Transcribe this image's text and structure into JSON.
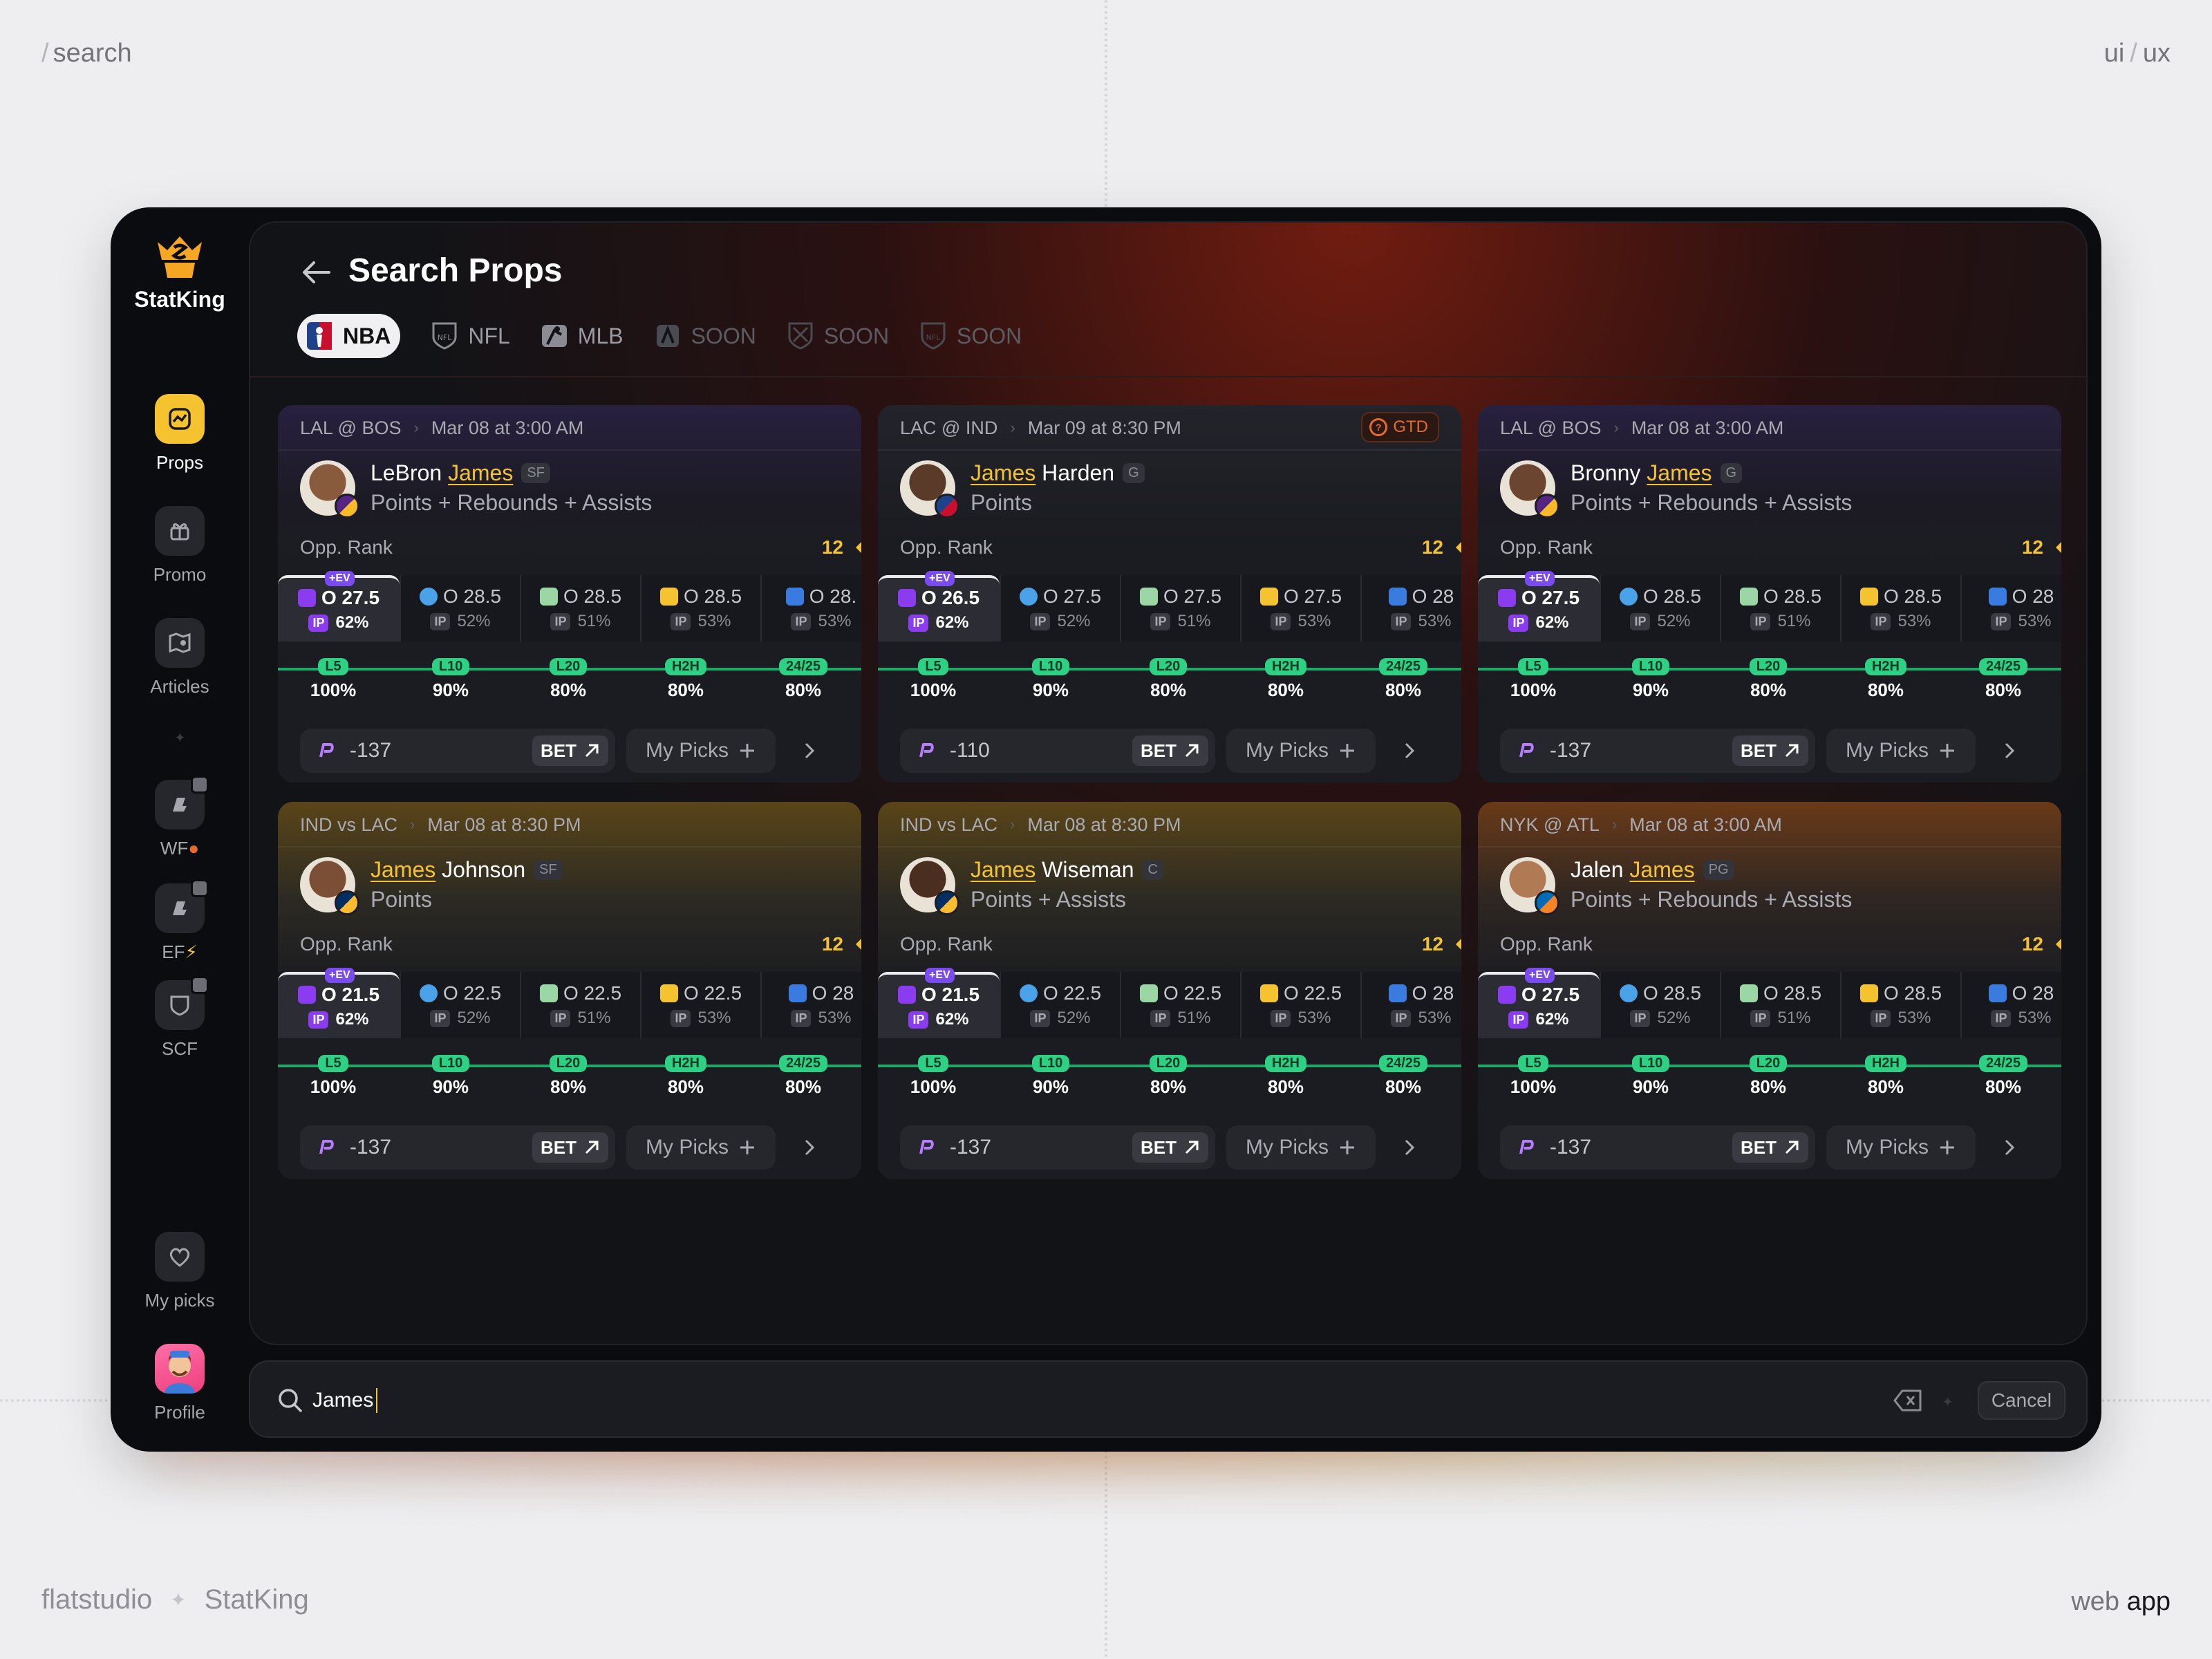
{
  "frame": {
    "top_left": "search",
    "top_right_a": "ui",
    "top_right_b": "ux",
    "bottom_left_studio": "flatstudio",
    "bottom_left_product": "StatKing",
    "bottom_right_a": "web",
    "bottom_right_b": "app"
  },
  "app": {
    "name": "StatKing",
    "accent": "#f5c230"
  },
  "sidebar": {
    "props": "Props",
    "promo": "Promo",
    "articles": "Articles",
    "wf": "WF",
    "ef": "EF",
    "scf": "SCF",
    "my_picks": "My picks",
    "profile": "Profile"
  },
  "header": {
    "title": "Search Props",
    "tabs": [
      {
        "label": "NBA",
        "active": true
      },
      {
        "label": "NFL"
      },
      {
        "label": "MLB"
      },
      {
        "label": "SOON",
        "disabled": true
      },
      {
        "label": "SOON",
        "disabled": true
      },
      {
        "label": "SOON",
        "disabled": true
      }
    ]
  },
  "common": {
    "opp_rank_label": "Opp. Rank",
    "ev_tag": "+EV",
    "ip_tag": "IP",
    "bet_label": "BET",
    "my_picks_label": "My Picks",
    "hist_labels": [
      "L5",
      "L10",
      "L20",
      "H2H",
      "24/25"
    ]
  },
  "cards": [
    {
      "game": "LAL @ BOS",
      "time": "Mar 08 at 3:00 AM",
      "name_pre": "LeBron ",
      "name_hl": "James",
      "name_post": "",
      "pos": "SF",
      "stat": "Points + Rebounds + Assists",
      "opp_rank": "12",
      "lines": [
        {
          "line": "O 27.5",
          "ip": "62%"
        },
        {
          "line": "O 28.5",
          "ip": "52%"
        },
        {
          "line": "O 28.5",
          "ip": "51%"
        },
        {
          "line": "O 28.5",
          "ip": "53%"
        },
        {
          "line": "O 28.",
          "ip": "53%"
        }
      ],
      "hist": [
        "100%",
        "90%",
        "80%",
        "80%",
        "80%"
      ],
      "odds": "-137"
    },
    {
      "game": "LAC @ IND",
      "time": "Mar 09 at 8:30 PM",
      "gtd": "GTD",
      "name_pre": "",
      "name_hl": "James",
      "name_post": " Harden",
      "pos": "G",
      "stat": "Points",
      "opp_rank": "12",
      "lines": [
        {
          "line": "O 26.5",
          "ip": "62%"
        },
        {
          "line": "O 27.5",
          "ip": "52%"
        },
        {
          "line": "O 27.5",
          "ip": "51%"
        },
        {
          "line": "O 27.5",
          "ip": "53%"
        },
        {
          "line": "O 28",
          "ip": "53%"
        }
      ],
      "hist": [
        "100%",
        "90%",
        "80%",
        "80%",
        "80%"
      ],
      "odds": "-110"
    },
    {
      "game": "LAL @ BOS",
      "time": "Mar 08 at 3:00 AM",
      "name_pre": "Bronny ",
      "name_hl": "James",
      "name_post": "",
      "pos": "G",
      "stat": "Points + Rebounds + Assists",
      "opp_rank": "12",
      "lines": [
        {
          "line": "O 27.5",
          "ip": "62%"
        },
        {
          "line": "O 28.5",
          "ip": "52%"
        },
        {
          "line": "O 28.5",
          "ip": "51%"
        },
        {
          "line": "O 28.5",
          "ip": "53%"
        },
        {
          "line": "O 28",
          "ip": "53%"
        }
      ],
      "hist": [
        "100%",
        "90%",
        "80%",
        "80%",
        "80%"
      ],
      "odds": "-137"
    },
    {
      "game": "IND vs LAC",
      "time": "Mar 08 at 8:30 PM",
      "name_pre": "",
      "name_hl": "James",
      "name_post": " Johnson",
      "pos": "SF",
      "stat": "Points",
      "opp_rank": "12",
      "lines": [
        {
          "line": "O 21.5",
          "ip": "62%"
        },
        {
          "line": "O 22.5",
          "ip": "52%"
        },
        {
          "line": "O 22.5",
          "ip": "51%"
        },
        {
          "line": "O 22.5",
          "ip": "53%"
        },
        {
          "line": "O 28",
          "ip": "53%"
        }
      ],
      "hist": [
        "100%",
        "90%",
        "80%",
        "80%",
        "80%"
      ],
      "odds": "-137"
    },
    {
      "game": "IND vs LAC",
      "time": "Mar 08 at 8:30 PM",
      "name_pre": "",
      "name_hl": "James",
      "name_post": " Wiseman",
      "pos": "C",
      "stat": "Points + Assists",
      "opp_rank": "12",
      "lines": [
        {
          "line": "O 21.5",
          "ip": "62%"
        },
        {
          "line": "O 22.5",
          "ip": "52%"
        },
        {
          "line": "O 22.5",
          "ip": "51%"
        },
        {
          "line": "O 22.5",
          "ip": "53%"
        },
        {
          "line": "O 28",
          "ip": "53%"
        }
      ],
      "hist": [
        "100%",
        "90%",
        "80%",
        "80%",
        "80%"
      ],
      "odds": "-137"
    },
    {
      "game": "NYK @ ATL",
      "time": "Mar 08 at 3:00 AM",
      "name_pre": "Jalen ",
      "name_hl": "James",
      "name_post": "",
      "pos": "PG",
      "stat": "Points + Rebounds + Assists",
      "opp_rank": "12",
      "lines": [
        {
          "line": "O 27.5",
          "ip": "62%"
        },
        {
          "line": "O 28.5",
          "ip": "52%"
        },
        {
          "line": "O 28.5",
          "ip": "51%"
        },
        {
          "line": "O 28.5",
          "ip": "53%"
        },
        {
          "line": "O 28",
          "ip": "53%"
        }
      ],
      "hist": [
        "100%",
        "90%",
        "80%",
        "80%",
        "80%"
      ],
      "odds": "-137"
    }
  ],
  "search": {
    "value": "James",
    "cancel": "Cancel"
  }
}
